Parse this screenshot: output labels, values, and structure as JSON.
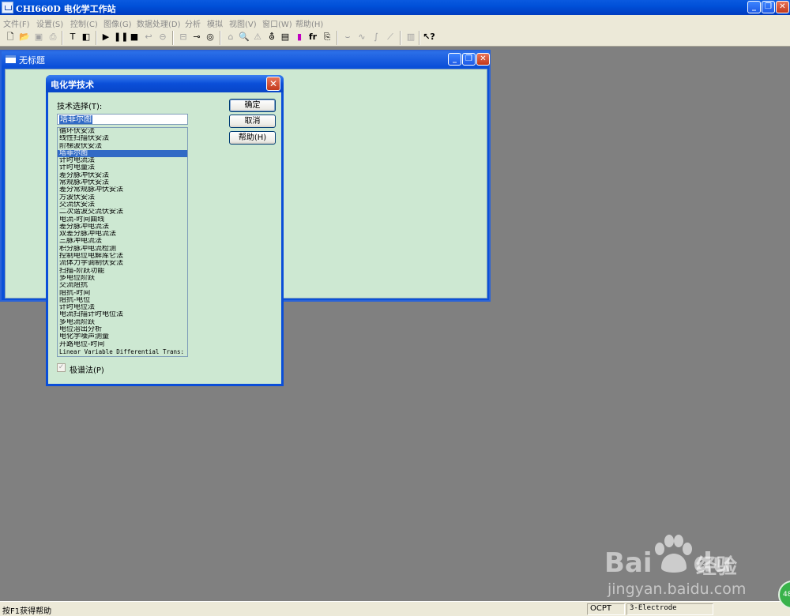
{
  "app": {
    "title": "CHI660D 电化学工作站"
  },
  "menu": [
    "文件(F)",
    "设置(S)",
    "控制(C)",
    "图像(G)",
    "数据处理(D)",
    "分析",
    "模拟",
    "视图(V)",
    "窗口(W)",
    "帮助(H)"
  ],
  "window_controls": {
    "minimize": "_",
    "restore": "❐",
    "close": "✕"
  },
  "child_window": {
    "title": "无标题"
  },
  "dialog": {
    "title": "电化学技术",
    "close": "✕",
    "select_label": "技术选择(T):",
    "selected_value": "塔菲尔图",
    "ok": "确定",
    "cancel": "取消",
    "help": "帮助(H)",
    "checkbox_mark": "✓",
    "checkbox_label": "极谱法(P)",
    "techniques": [
      "循环伏安法",
      "线性扫描伏安法",
      "阶梯波伏安法",
      "塔菲尔图",
      "计时电流法",
      "计时电量法",
      "差分脉冲伏安法",
      "常规脉冲伏安法",
      "差分常规脉冲伏安法",
      "方波伏安法",
      "交流伏安法",
      "二次谐波交流伏安法",
      "电流-时间曲线",
      "差分脉冲电流法",
      "双差分脉冲电流法",
      "三脉冲电流法",
      "积分脉冲电流检测",
      "控制电位电解库仑法",
      "流体力学调制伏安法",
      "扫描-阶跃功能",
      "多电位阶跃",
      "交流阻抗",
      "阻抗-时间",
      "阻抗-电位",
      "计时电位法",
      "电流扫描计时电位法",
      "多电流阶跃",
      "电位溶出分析",
      "电化学噪声测量",
      "开路电位-时间",
      "Linear Variable Differential Trans:"
    ],
    "selected_index": 3
  },
  "status": {
    "help": "按F1获得帮助",
    "ocpt": "OCPT",
    "electrode": "3-Electrode"
  },
  "watermark": {
    "brand": "Bai",
    "brand2": "du",
    "sub": "经验",
    "url": "jingyan.baidu.com"
  },
  "badge": "48"
}
